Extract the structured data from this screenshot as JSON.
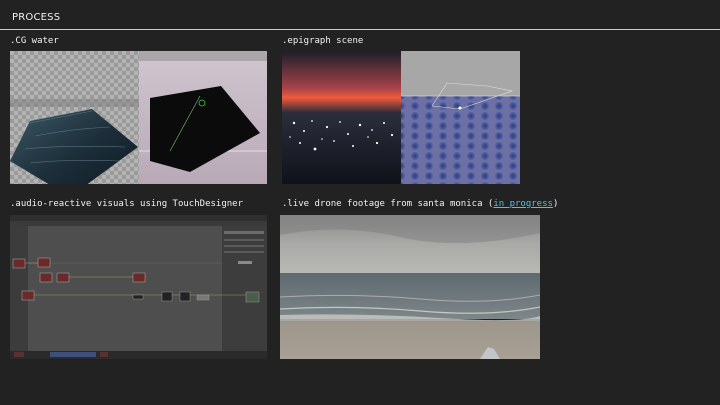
{
  "header": {
    "title": "PROCESS"
  },
  "items": [
    {
      "caption": ".CG water"
    },
    {
      "caption": ".epigraph scene"
    },
    {
      "caption": ".audio-reactive visuals using TouchDesigner"
    },
    {
      "caption_prefix": ".live drone footage from santa monica (",
      "link": "in progress",
      "caption_suffix": ")"
    }
  ]
}
